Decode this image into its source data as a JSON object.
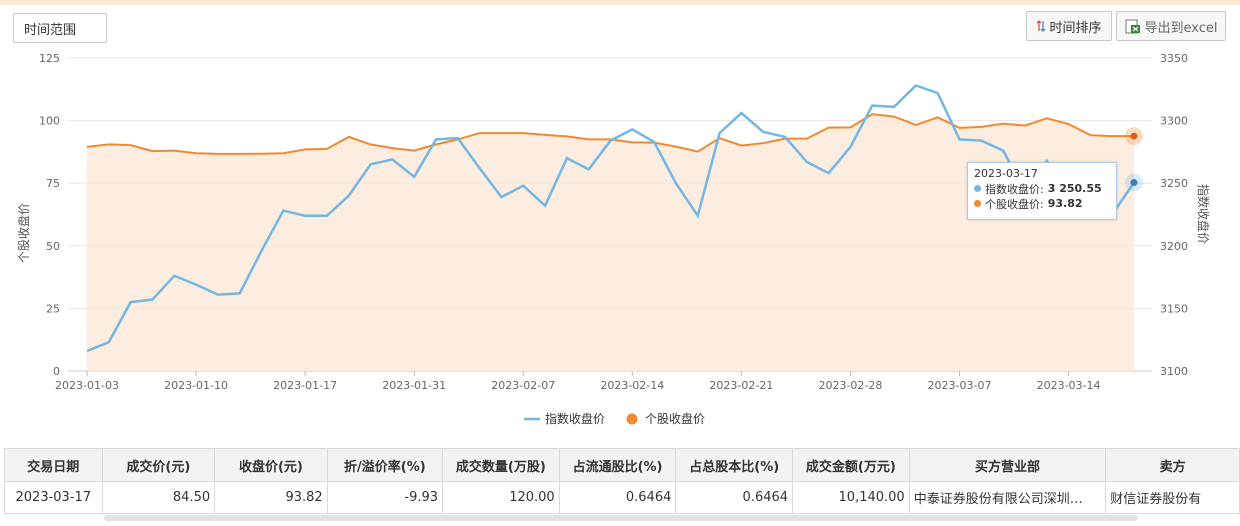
{
  "toolbar": {
    "range_label": "时间范围",
    "sort_label": "时间排序",
    "export_label": "导出到excel"
  },
  "colors": {
    "index": "#74b6e2",
    "stock": "#f08a32",
    "area": "#fde9db"
  },
  "chart_data": {
    "type": "line",
    "x": [
      "2023-01-03",
      "2023-01-04",
      "2023-01-05",
      "2023-01-06",
      "2023-01-09",
      "2023-01-10",
      "2023-01-11",
      "2023-01-12",
      "2023-01-13",
      "2023-01-16",
      "2023-01-17",
      "2023-01-18",
      "2023-01-19",
      "2023-01-20",
      "2023-01-30",
      "2023-01-31",
      "2023-02-01",
      "2023-02-02",
      "2023-02-03",
      "2023-02-06",
      "2023-02-07",
      "2023-02-08",
      "2023-02-09",
      "2023-02-10",
      "2023-02-13",
      "2023-02-14",
      "2023-02-15",
      "2023-02-16",
      "2023-02-17",
      "2023-02-20",
      "2023-02-21",
      "2023-02-22",
      "2023-02-23",
      "2023-02-24",
      "2023-02-27",
      "2023-02-28",
      "2023-03-01",
      "2023-03-02",
      "2023-03-03",
      "2023-03-06",
      "2023-03-07",
      "2023-03-08",
      "2023-03-09",
      "2023-03-10",
      "2023-03-13",
      "2023-03-14",
      "2023-03-15",
      "2023-03-16",
      "2023-03-17"
    ],
    "xticks": [
      "2023-01-03",
      "2023-01-10",
      "2023-01-17",
      "2023-01-31",
      "2023-02-07",
      "2023-02-14",
      "2023-02-21",
      "2023-02-28",
      "2023-03-07",
      "2023-03-14"
    ],
    "yleft_ticks": [
      0,
      25,
      50,
      75,
      100,
      125
    ],
    "yright_ticks": [
      3100,
      3150,
      3200,
      3250,
      3300,
      3350
    ],
    "ylim_left": [
      0,
      125
    ],
    "ylim_right": [
      3100,
      3350
    ],
    "ylabel_left": "个股收盘价",
    "ylabel_right": "指数收盘价",
    "series": [
      {
        "name": "指数收盘价",
        "axis": "right",
        "values": [
          3116,
          3123,
          3155,
          3157,
          3176,
          3169,
          3161,
          3162,
          3196,
          3228,
          3224,
          3224,
          3240,
          3265,
          3269,
          3255,
          3285,
          3286,
          3262,
          3239,
          3248,
          3232,
          3270,
          3261,
          3284,
          3293,
          3283,
          3250,
          3224,
          3290,
          3306,
          3291,
          3287,
          3267,
          3258,
          3279,
          3312,
          3311,
          3328,
          3322,
          3285,
          3284,
          3276,
          3244,
          3268,
          3242,
          3262,
          3225,
          3250.55
        ]
      },
      {
        "name": "个股收盘价",
        "axis": "left",
        "values": [
          89.5,
          90.5,
          90.2,
          87.8,
          88,
          87,
          86.7,
          86.7,
          86.8,
          87,
          88.5,
          88.7,
          93.5,
          90.5,
          89,
          88,
          90.5,
          92.5,
          95,
          95,
          95,
          94.3,
          93.7,
          92.5,
          92.5,
          91.3,
          91.2,
          89.6,
          87.6,
          93,
          90,
          91,
          92.8,
          92.8,
          97.2,
          97.3,
          102.6,
          101.6,
          98.3,
          101.3,
          97.1,
          97.5,
          98.8,
          98,
          100.9,
          98.6,
          94.2,
          93.8,
          93.82
        ]
      }
    ],
    "legend_position": "bottom-center",
    "tooltip": {
      "date": "2023-03-17",
      "index_label": "指数收盘价:",
      "index_value": "3 250.55",
      "stock_label": "个股收盘价:",
      "stock_value": "93.82"
    }
  },
  "table": {
    "headers": [
      "交易日期",
      "成交价(元)",
      "收盘价(元)",
      "折/溢价率(%)",
      "成交数量(万股)",
      "占流通股比(%)",
      "占总股本比(%)",
      "成交金额(万元)",
      "买方营业部",
      "卖方"
    ],
    "rows": [
      [
        "2023-03-17",
        "84.50",
        "93.82",
        "-9.93",
        "120.00",
        "0.6464",
        "0.6464",
        "10,140.00",
        "中泰证券股份有限公司深圳…",
        "财信证券股份有"
      ]
    ]
  }
}
